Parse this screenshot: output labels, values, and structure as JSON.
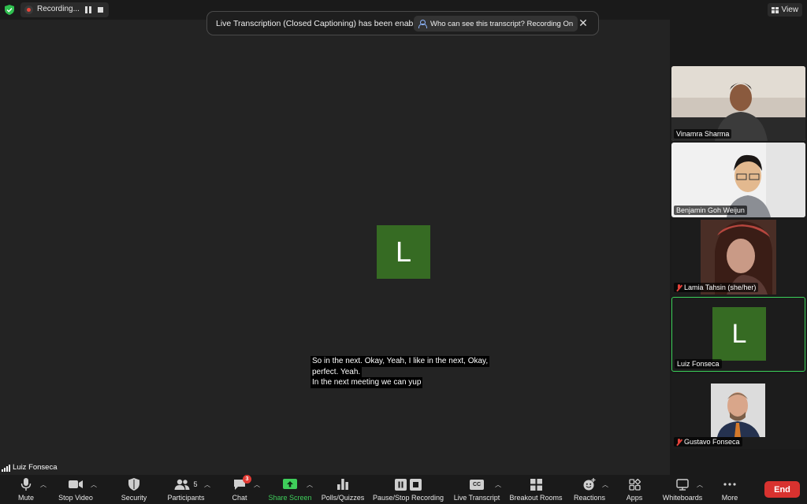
{
  "topbar": {
    "recording_label": "Recording...",
    "view_label": "View"
  },
  "notification": {
    "message": "Live Transcription (Closed Captioning) has been enabled",
    "link_label": "Who can see this transcript? Recording On"
  },
  "stage": {
    "active_initial": "L",
    "active_speaker": "Luiz Fonseca",
    "captions": [
      "So in the next. Okay, Yeah, I like in the next, Okay,",
      "perfect. Yeah.",
      "In the next meeting we can yup"
    ]
  },
  "participants": [
    {
      "name": "Vinamra Sharma",
      "muted": false,
      "video": true
    },
    {
      "name": "Benjamin Goh Weijun",
      "muted": false,
      "video": true
    },
    {
      "name": "Lamia Tahsin (she/her)",
      "muted": true,
      "video": true
    },
    {
      "name": "Luiz Fonseca",
      "muted": false,
      "video": false,
      "initial": "L",
      "active": true
    },
    {
      "name": "Gustavo Fonseca",
      "muted": true,
      "video": true
    }
  ],
  "toolbar": {
    "mute": "Mute",
    "stop_video": "Stop Video",
    "security": "Security",
    "participants": "Participants",
    "participants_count": "5",
    "chat": "Chat",
    "chat_badge": "3",
    "share_screen": "Share Screen",
    "polls": "Polls/Quizzes",
    "recording": "Pause/Stop Recording",
    "live_transcript": "Live Transcript",
    "breakout_rooms": "Breakout Rooms",
    "reactions": "Reactions",
    "apps": "Apps",
    "whiteboards": "Whiteboards",
    "more": "More",
    "end": "End",
    "cc_icon_text": "CC"
  },
  "colors": {
    "avatar_green": "#366b23",
    "end_red": "#d8322f",
    "share_green": "#3fce5b",
    "active_border": "#3bd25a"
  }
}
